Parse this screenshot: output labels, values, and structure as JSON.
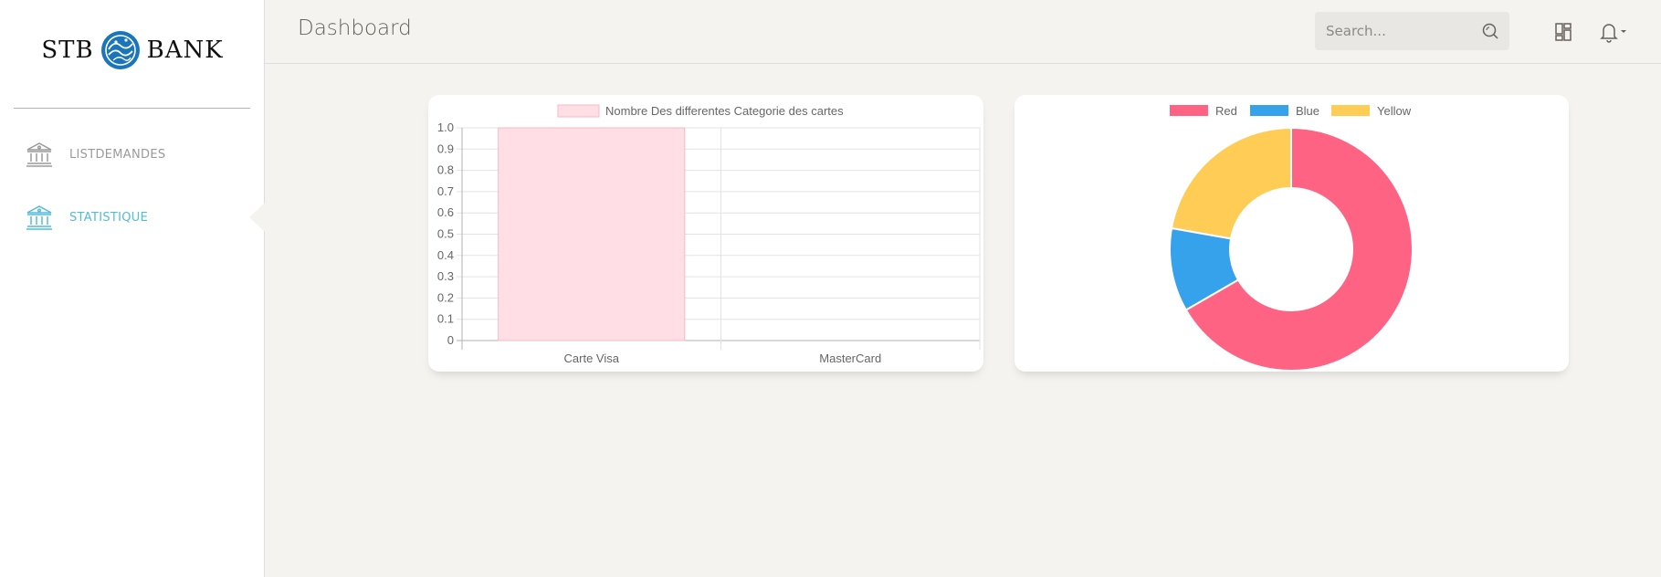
{
  "brand": {
    "name_left": "STB",
    "name_right": "BANK",
    "emblem_color": "#1a75bb"
  },
  "sidebar": {
    "items": [
      {
        "label": "LISTDEMANDES",
        "icon": "bank-icon",
        "active": false
      },
      {
        "label": "STATISTIQUE",
        "icon": "bank-icon",
        "active": true
      }
    ],
    "active_color": "#51bcda"
  },
  "navbar": {
    "title": "Dashboard",
    "search": {
      "placeholder": "Search...",
      "value": ""
    },
    "icons": [
      "search-icon",
      "dashboard-grid-icon",
      "bell-icon",
      "caret-down-icon"
    ]
  },
  "chart_data": [
    {
      "type": "bar",
      "categories": [
        "Carte Visa",
        "MasterCard"
      ],
      "series": [
        {
          "name": "Nombre Des differentes Categorie des cartes",
          "values": [
            1,
            0
          ],
          "color": "#ffdfe5",
          "border_color": "#f7b9c5"
        }
      ],
      "ylim": [
        0,
        1.0
      ],
      "yticks": [
        "1.0",
        "0.9",
        "0.8",
        "0.7",
        "0.6",
        "0.5",
        "0.4",
        "0.3",
        "0.2",
        "0.1",
        "0"
      ],
      "grid": true,
      "legend": "top"
    },
    {
      "type": "pie",
      "variant": "doughnut",
      "labels": [
        "Red",
        "Blue",
        "Yellow"
      ],
      "values": [
        300,
        50,
        100
      ],
      "colors": [
        "#ff6384",
        "#36a2eb",
        "#ffcd56"
      ],
      "legend": "top"
    }
  ]
}
